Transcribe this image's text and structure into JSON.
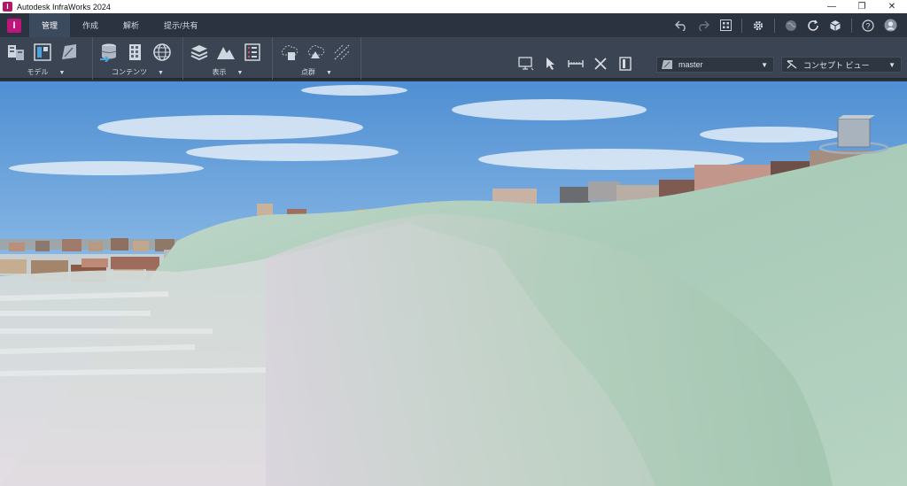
{
  "window": {
    "title": "Autodesk InfraWorks 2024",
    "minimize_glyph": "—",
    "restore_glyph": "❐",
    "close_glyph": "✕"
  },
  "app_logo": {
    "letter": "I",
    "color": "#c0147a"
  },
  "tabs": [
    {
      "label": "管理",
      "active": true
    },
    {
      "label": "作成",
      "active": false
    },
    {
      "label": "解析",
      "active": false
    },
    {
      "label": "提示/共有",
      "active": false
    }
  ],
  "ribbon": {
    "groups": [
      {
        "label": "モデル"
      },
      {
        "label": "コンテンツ"
      },
      {
        "label": "表示"
      },
      {
        "label": "点群"
      }
    ],
    "proposal": {
      "value": "master"
    },
    "visual_style": {
      "value": "コンセプト ビュー"
    }
  },
  "right_tools": {
    "help_glyph": "?"
  },
  "colors": {
    "chrome_dark": "#2b3240",
    "ribbon": "#3a4452",
    "sky_top": "#4f8fd3",
    "terrain": "#a9cbb8"
  }
}
